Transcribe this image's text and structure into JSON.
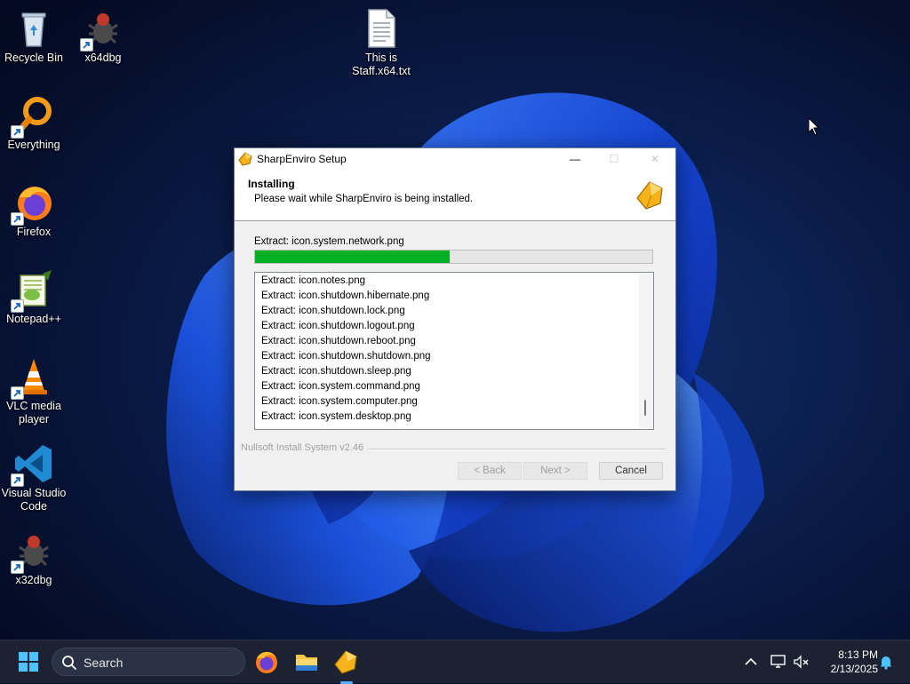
{
  "desktop": {
    "icons": [
      {
        "label": "Recycle Bin",
        "icon": "recycle-bin-icon",
        "shortcut": false
      },
      {
        "label": "x64dbg",
        "icon": "bug-icon",
        "shortcut": true
      },
      {
        "label": "This is Staff.x64.txt",
        "icon": "text-file-icon",
        "shortcut": false
      },
      {
        "label": "Everything",
        "icon": "magnifier-icon",
        "shortcut": true
      },
      {
        "label": "Firefox",
        "icon": "firefox-icon",
        "shortcut": true
      },
      {
        "label": "Notepad++",
        "icon": "notepad-plus-plus-icon",
        "shortcut": true
      },
      {
        "label": "VLC media player",
        "icon": "vlc-cone-icon",
        "shortcut": true
      },
      {
        "label": "Visual Studio Code",
        "icon": "vscode-icon",
        "shortcut": true
      },
      {
        "label": "x32dbg",
        "icon": "bug-icon",
        "shortcut": true
      }
    ]
  },
  "setup": {
    "title": "SharpEnviro Setup",
    "minimize_glyph": "—",
    "maximize_glyph": "☐",
    "close_glyph": "✕",
    "header_title": "Installing",
    "header_subtitle": "Please wait while SharpEnviro is being installed.",
    "status": "Extract: icon.system.network.png",
    "progress_percent": 49,
    "log": [
      "Extract: icon.notes.png",
      "Extract: icon.shutdown.hibernate.png",
      "Extract: icon.shutdown.lock.png",
      "Extract: icon.shutdown.logout.png",
      "Extract: icon.shutdown.reboot.png",
      "Extract: icon.shutdown.shutdown.png",
      "Extract: icon.shutdown.sleep.png",
      "Extract: icon.system.command.png",
      "Extract: icon.system.computer.png",
      "Extract: icon.system.desktop.png"
    ],
    "branding": "Nullsoft Install System v2.46",
    "buttons": {
      "back": "< Back",
      "next": "Next >",
      "cancel": "Cancel"
    },
    "accent_color": "#06b025"
  },
  "taskbar": {
    "search_placeholder": "Search",
    "pinned": [
      "windows-start-icon",
      "firefox-icon",
      "file-explorer-icon",
      "sharpenviro-setup-icon"
    ],
    "tray": [
      "chevron-up-icon",
      "network-icon",
      "volume-muted-icon",
      "notification-bell-icon"
    ],
    "time": "8:13 PM",
    "date": "2/13/2025"
  }
}
